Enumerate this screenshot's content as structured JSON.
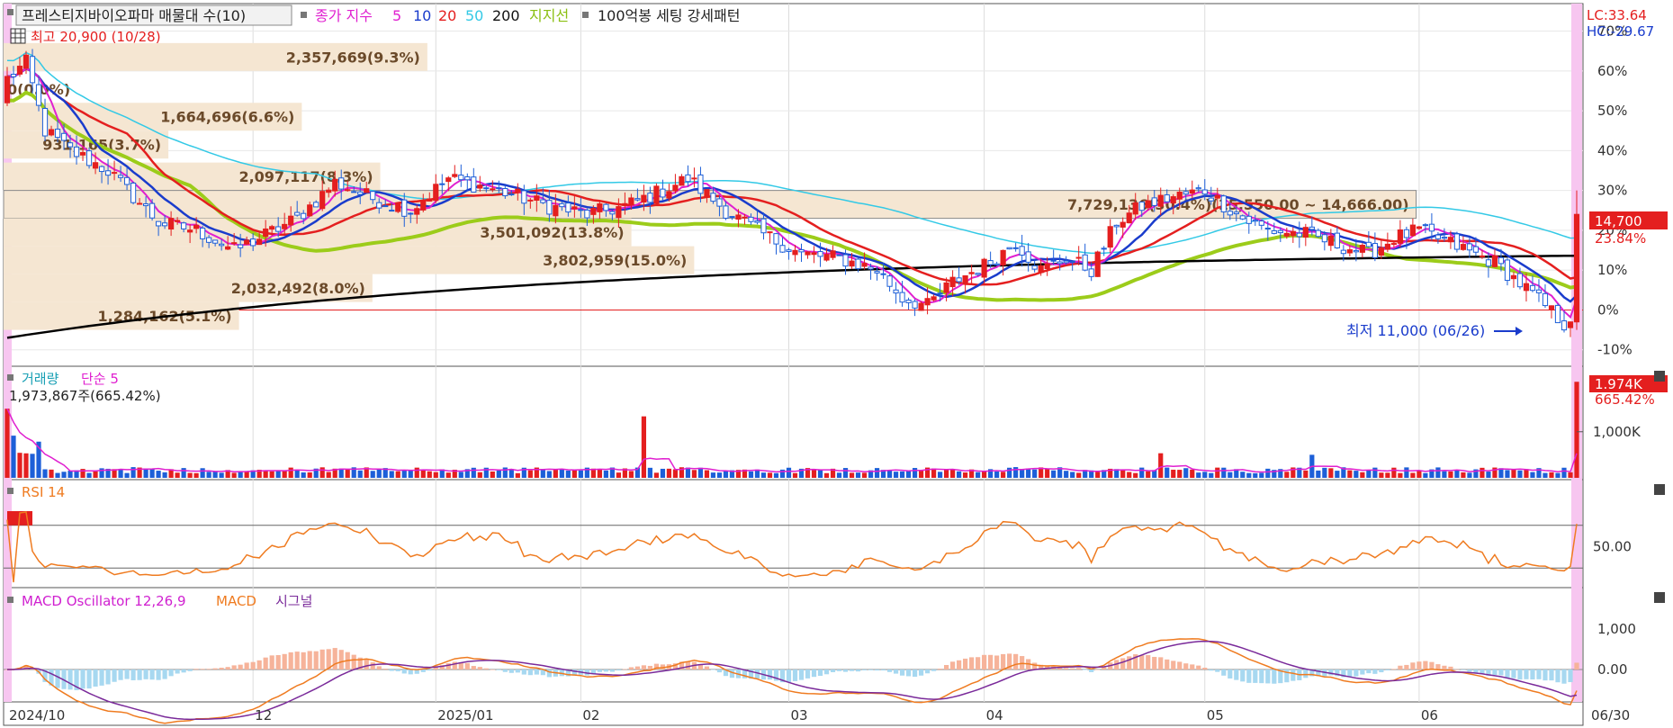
{
  "header": {
    "stock_title": "프레스티지바이오파마 매물대 수(10)",
    "ma_label": "종가 지수",
    "ma_periods": [
      "5",
      "10",
      "20",
      "50",
      "200"
    ],
    "support_label": "지지선",
    "pattern_label": "100억봉 세팅 강세패턴",
    "high_label": "최고 20,900 (10/28)",
    "low_label": "최저 11,000 (06/26)"
  },
  "right_labels": {
    "lc": "LC:33.64",
    "hc": "HC:-29.67",
    "last_price": "14,700",
    "last_change": "23.84%",
    "volume_last": "1.974K",
    "volume_change": "665.42%"
  },
  "colors": {
    "ma5": "#e020d0",
    "ma10": "#1a3ccc",
    "ma20": "#e41f1f",
    "ma50": "#33c9e6",
    "ma200": "#000000",
    "support": "#9ccc1a",
    "up": "#e41f1f",
    "down": "#1d5fd8",
    "zone": "#f5e6d2",
    "highlight": "#f7c6f0"
  },
  "chart_data": [
    {
      "type": "candlestick",
      "name": "price",
      "y_axis_ticks": [
        "70%",
        "60%",
        "50%",
        "40%",
        "30%",
        "20%",
        "10%",
        "0%",
        "-10%"
      ],
      "ylim_pct": [
        -13,
        76
      ],
      "x_tick_labels": [
        "2024/10",
        "12",
        "2025/01",
        "02",
        "03",
        "04",
        "05",
        "06",
        "06/30"
      ],
      "month_index": [
        0,
        39,
        68,
        91,
        124,
        155,
        190,
        224
      ],
      "volume_profile": [
        {
          "label": "2,357,669(9.3%)",
          "pct_low": 60,
          "pct_high": 67,
          "frac": 0.27
        },
        {
          "label": "1,664,696(6.6%)",
          "pct_low": 45,
          "pct_high": 52,
          "frac": 0.19
        },
        {
          "label": "931,165(3.7%)",
          "pct_low": 38,
          "pct_high": 45,
          "frac": 0.105
        },
        {
          "label": "2,097,117(8.3%)",
          "pct_low": 30,
          "pct_high": 37,
          "frac": 0.24
        },
        {
          "label": "7,729,136(30.4%)(15,550.00 ~ 14,666.00)",
          "pct_low": 23,
          "pct_high": 30,
          "frac": 0.9
        },
        {
          "label": "3,501,092(13.8%)",
          "pct_low": 16,
          "pct_high": 23,
          "frac": 0.4
        },
        {
          "label": "3,802,959(15.0%)",
          "pct_low": 9,
          "pct_high": 16,
          "frac": 0.44
        },
        {
          "label": "2,032,492(8.0%)",
          "pct_low": 2,
          "pct_high": 9,
          "frac": 0.235
        },
        {
          "label": "1,284,162(5.1%)",
          "pct_low": -5,
          "pct_high": 2,
          "frac": 0.15
        },
        {
          "label": "0(0.0%)",
          "pct_low": 52,
          "pct_high": 59,
          "frac": 0.0
        }
      ]
    },
    {
      "type": "bar",
      "name": "volume",
      "legend": [
        "거래량",
        "단순 5"
      ],
      "info": "1,973,867주(665.42%)",
      "y_axis_ticks": [
        "1,000K"
      ]
    },
    {
      "type": "line",
      "name": "rsi",
      "legend": [
        "RSI 14"
      ],
      "y_axis_ticks": [
        "50.00"
      ]
    },
    {
      "type": "bar",
      "name": "macd",
      "legend": [
        "MACD Oscillator 12,26,9",
        "MACD",
        "시그널"
      ],
      "y_axis_ticks": [
        "1,000",
        "0.00"
      ]
    }
  ]
}
